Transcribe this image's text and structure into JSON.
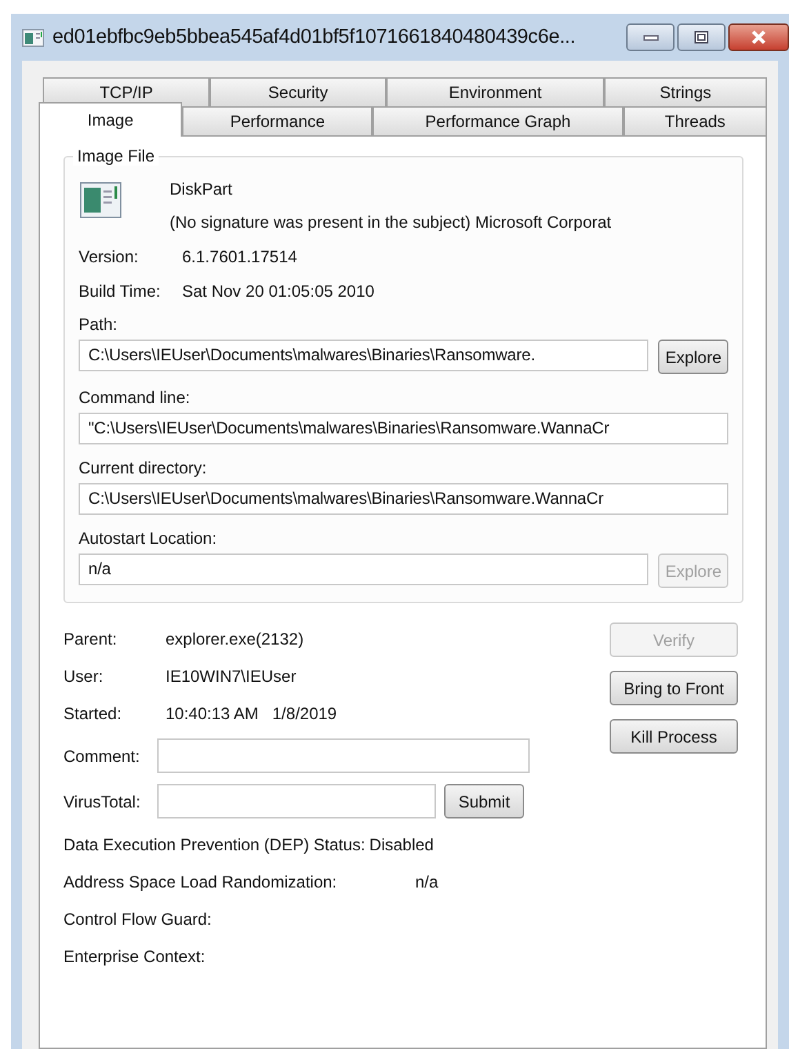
{
  "window": {
    "title": "ed01ebfbc9eb5bbea545af4d01bf5f1071661840480439c6e..."
  },
  "tab_rows": [
    [
      {
        "label": "TCP/IP",
        "selected": false
      },
      {
        "label": "Security",
        "selected": false
      },
      {
        "label": "Environment",
        "selected": false
      },
      {
        "label": "Strings",
        "selected": false
      }
    ],
    [
      {
        "label": "Image",
        "selected": true
      },
      {
        "label": "Performance",
        "selected": false
      },
      {
        "label": "Performance Graph",
        "selected": false
      },
      {
        "label": "Threads",
        "selected": false
      }
    ]
  ],
  "image_file": {
    "title": "Image File",
    "description": "DiskPart",
    "company": "(No signature was present in the subject) Microsoft Corporat",
    "info": [
      {
        "label": "Version:",
        "value": "6.1.7601.17514"
      },
      {
        "label": "Build Time:",
        "value": "Sat Nov 20 01:05:05 2010"
      }
    ],
    "paths": [
      {
        "label": "Path:",
        "value": "C:\\Users\\IEUser\\Documents\\malwares\\Binaries\\Ransomware.",
        "button": {
          "label": "Explore",
          "disabled": false
        }
      },
      {
        "label": "Command line:",
        "value": "\"C:\\Users\\IEUser\\Documents\\malwares\\Binaries\\Ransomware.WannaCr"
      },
      {
        "label": "Current directory:",
        "value": "C:\\Users\\IEUser\\Documents\\malwares\\Binaries\\Ransomware.WannaCr"
      },
      {
        "label": "Autostart Location:",
        "value": "n/a",
        "button": {
          "label": "Explore",
          "disabled": true
        }
      }
    ]
  },
  "process": [
    {
      "label": "Parent:",
      "value": "explorer.exe(2132)"
    },
    {
      "label": "User:",
      "value": "IE10WIN7\\IEUser"
    },
    {
      "label": "Started:",
      "value": "10:40:13 AM   1/8/2019"
    }
  ],
  "inputs": [
    {
      "label": "Comment:"
    },
    {
      "label": "VirusTotal:",
      "button": "Submit"
    }
  ],
  "actions": [
    {
      "label": "Verify",
      "disabled": true
    },
    {
      "label": "Bring to Front",
      "disabled": false
    },
    {
      "label": "Kill Process",
      "disabled": false
    }
  ],
  "security": [
    {
      "label": "Data Execution Prevention (DEP) Status:",
      "value": "Disabled"
    },
    {
      "label": "Address Space Load Randomization:",
      "value": "n/a"
    },
    {
      "label": "Control Flow Guard:"
    },
    {
      "label": "Enterprise Context:"
    }
  ]
}
